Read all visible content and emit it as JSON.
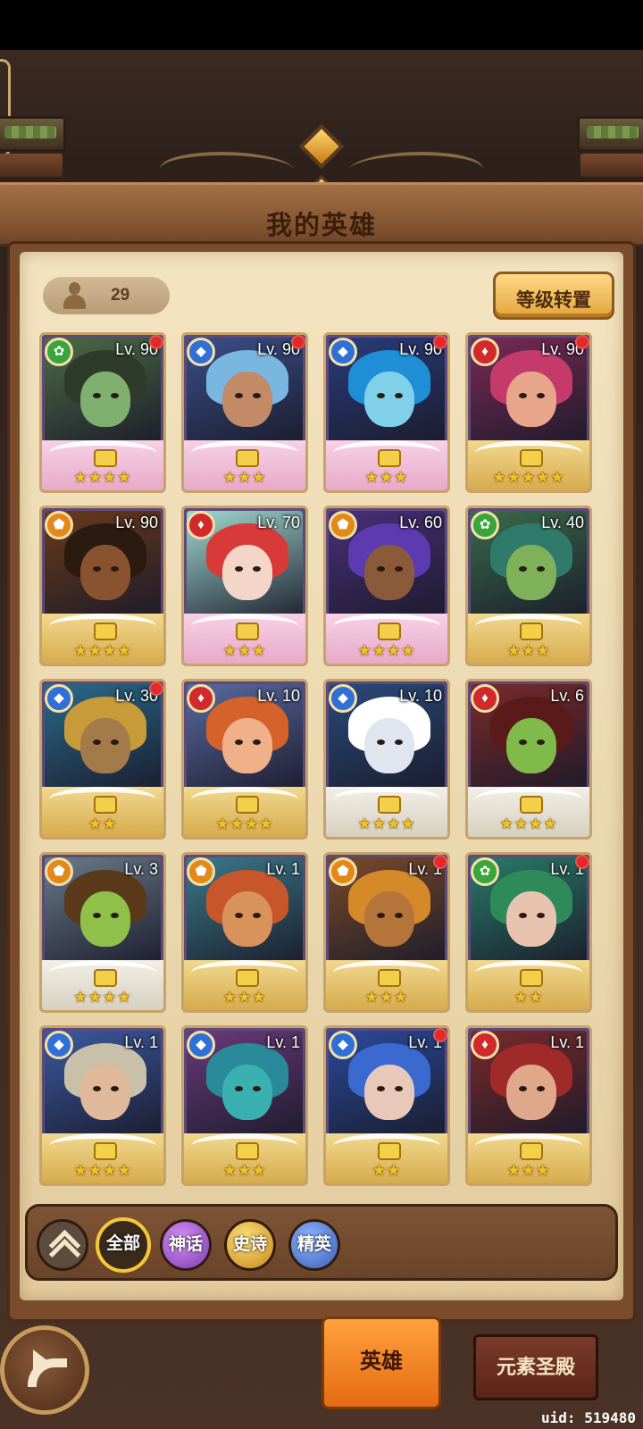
{
  "header": {
    "title": "我的英雄"
  },
  "hero_count": "29",
  "level_transfer_label": "等级转置",
  "heroes": [
    {
      "level": "Lv. 90",
      "element": "nature",
      "stars": "★★★★",
      "red_dot": true,
      "base": "pink",
      "palette": [
        "#4d6b46",
        "#7fb070",
        "#2f3b2a"
      ]
    },
    {
      "level": "Lv. 90",
      "element": "water",
      "stars": "★★★",
      "red_dot": true,
      "base": "pink",
      "palette": [
        "#3a4f88",
        "#c28a66",
        "#7ab7e0"
      ]
    },
    {
      "level": "Lv. 90",
      "element": "water",
      "stars": "★★★",
      "red_dot": true,
      "base": "pink",
      "palette": [
        "#2a3c7a",
        "#7fd0e8",
        "#1e8fd6"
      ]
    },
    {
      "level": "Lv. 90",
      "element": "fire",
      "stars": "★★★★★",
      "red_dot": true,
      "base": "gold",
      "palette": [
        "#7a2a56",
        "#e7a58c",
        "#c43a6a"
      ]
    },
    {
      "level": "Lv. 90",
      "element": "earth",
      "stars": "★★★★",
      "red_dot": false,
      "base": "gold",
      "palette": [
        "#6a3a1a",
        "#8a5330",
        "#2a1a10"
      ]
    },
    {
      "level": "Lv. 70",
      "element": "fire",
      "stars": "★★★",
      "red_dot": false,
      "base": "pink",
      "palette": [
        "#a0d8d0",
        "#f3d6c8",
        "#d83a3a"
      ]
    },
    {
      "level": "Lv. 60",
      "element": "earth",
      "stars": "★★★★",
      "red_dot": false,
      "base": "pink",
      "palette": [
        "#4a2f7a",
        "#8a5a3a",
        "#5c3ab0"
      ]
    },
    {
      "level": "Lv. 40",
      "element": "nature",
      "stars": "★★★",
      "red_dot": false,
      "base": "gold",
      "palette": [
        "#3a6b4a",
        "#7fb05a",
        "#2f7a6a"
      ]
    },
    {
      "level": "Lv. 30",
      "element": "water",
      "stars": "★★",
      "red_dot": true,
      "base": "gold",
      "palette": [
        "#2a6a8a",
        "#a47a4a",
        "#c79a3a"
      ]
    },
    {
      "level": "Lv. 10",
      "element": "fire",
      "stars": "★★★★",
      "red_dot": false,
      "base": "gold",
      "palette": [
        "#5a6aa0",
        "#f0b08a",
        "#d5622a"
      ]
    },
    {
      "level": "Lv. 10",
      "element": "water",
      "stars": "★★★★",
      "red_dot": false,
      "base": "silver",
      "palette": [
        "#2a4a7a",
        "#dfe6f0",
        "#ffffff"
      ]
    },
    {
      "level": "Lv. 6",
      "element": "fire",
      "stars": "★★★★",
      "red_dot": false,
      "base": "silver",
      "palette": [
        "#7a2a2a",
        "#7fba4a",
        "#5a1a1a"
      ]
    },
    {
      "level": "Lv. 3",
      "element": "earth",
      "stars": "★★★★",
      "red_dot": false,
      "base": "silver",
      "palette": [
        "#6a7a8a",
        "#8fc04a",
        "#5a3a1a"
      ]
    },
    {
      "level": "Lv. 1",
      "element": "earth",
      "stars": "★★★",
      "red_dot": false,
      "base": "gold",
      "palette": [
        "#3a7a8a",
        "#d9925a",
        "#c7562a"
      ]
    },
    {
      "level": "Lv. 1",
      "element": "earth",
      "stars": "★★★",
      "red_dot": true,
      "base": "gold",
      "palette": [
        "#7a4a2a",
        "#b5753a",
        "#d58a2a"
      ]
    },
    {
      "level": "Lv. 1",
      "element": "nature",
      "stars": "★★",
      "red_dot": true,
      "base": "gold",
      "palette": [
        "#2a7a6a",
        "#e8c4b0",
        "#2f8a5a"
      ]
    },
    {
      "level": "Lv. 1",
      "element": "water",
      "stars": "★★★★",
      "red_dot": false,
      "base": "gold",
      "palette": [
        "#3a5aa0",
        "#e0b89a",
        "#c8c0a8"
      ]
    },
    {
      "level": "Lv. 1",
      "element": "water",
      "stars": "★★★",
      "red_dot": false,
      "base": "gold",
      "palette": [
        "#6a3a7a",
        "#3ab0b0",
        "#2a8a9a"
      ]
    },
    {
      "level": "Lv. 1",
      "element": "water",
      "stars": "★★",
      "red_dot": true,
      "base": "gold",
      "palette": [
        "#2a4a9a",
        "#e8c8b8",
        "#3a6ad0"
      ]
    },
    {
      "level": "Lv. 1",
      "element": "fire",
      "stars": "★★★",
      "red_dot": false,
      "base": "gold",
      "palette": [
        "#7a2a2a",
        "#e0a88a",
        "#a02a2a"
      ]
    }
  ],
  "filters": {
    "all": "全部",
    "mythic": "神话",
    "epic": "史诗",
    "elite": "精英"
  },
  "nav": {
    "heroes_tab": "英雄",
    "element_temple_tab": "元素圣殿"
  },
  "uid": "uid: 519480",
  "colors": {
    "accent_gold": "#f6c739",
    "active_tab": "#e46a12",
    "notification_red": "#e12a2a"
  }
}
